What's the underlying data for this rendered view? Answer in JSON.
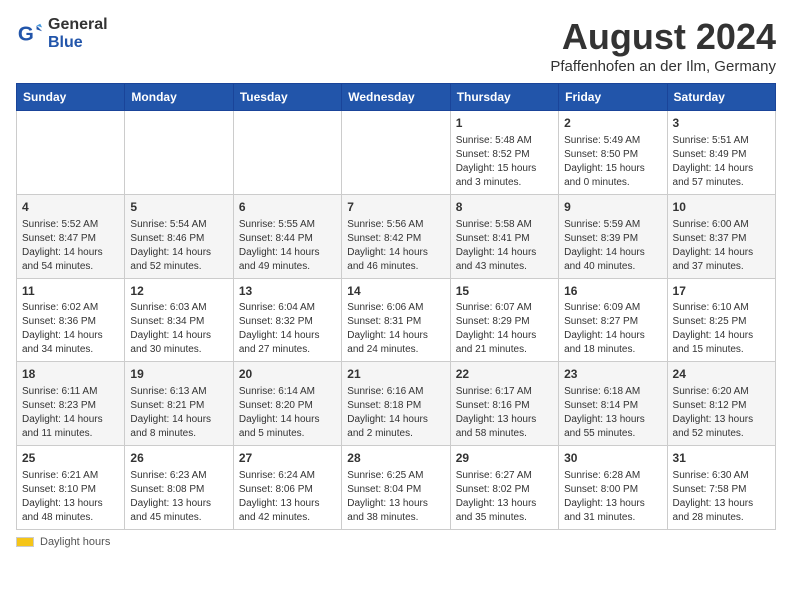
{
  "logo": {
    "general": "General",
    "blue": "Blue"
  },
  "title": "August 2024",
  "subtitle": "Pfaffenhofen an der Ilm, Germany",
  "days_of_week": [
    "Sunday",
    "Monday",
    "Tuesday",
    "Wednesday",
    "Thursday",
    "Friday",
    "Saturday"
  ],
  "weeks": [
    [
      {
        "day": "",
        "content": ""
      },
      {
        "day": "",
        "content": ""
      },
      {
        "day": "",
        "content": ""
      },
      {
        "day": "",
        "content": ""
      },
      {
        "day": "1",
        "content": "Sunrise: 5:48 AM\nSunset: 8:52 PM\nDaylight: 15 hours and 3 minutes."
      },
      {
        "day": "2",
        "content": "Sunrise: 5:49 AM\nSunset: 8:50 PM\nDaylight: 15 hours and 0 minutes."
      },
      {
        "day": "3",
        "content": "Sunrise: 5:51 AM\nSunset: 8:49 PM\nDaylight: 14 hours and 57 minutes."
      }
    ],
    [
      {
        "day": "4",
        "content": "Sunrise: 5:52 AM\nSunset: 8:47 PM\nDaylight: 14 hours and 54 minutes."
      },
      {
        "day": "5",
        "content": "Sunrise: 5:54 AM\nSunset: 8:46 PM\nDaylight: 14 hours and 52 minutes."
      },
      {
        "day": "6",
        "content": "Sunrise: 5:55 AM\nSunset: 8:44 PM\nDaylight: 14 hours and 49 minutes."
      },
      {
        "day": "7",
        "content": "Sunrise: 5:56 AM\nSunset: 8:42 PM\nDaylight: 14 hours and 46 minutes."
      },
      {
        "day": "8",
        "content": "Sunrise: 5:58 AM\nSunset: 8:41 PM\nDaylight: 14 hours and 43 minutes."
      },
      {
        "day": "9",
        "content": "Sunrise: 5:59 AM\nSunset: 8:39 PM\nDaylight: 14 hours and 40 minutes."
      },
      {
        "day": "10",
        "content": "Sunrise: 6:00 AM\nSunset: 8:37 PM\nDaylight: 14 hours and 37 minutes."
      }
    ],
    [
      {
        "day": "11",
        "content": "Sunrise: 6:02 AM\nSunset: 8:36 PM\nDaylight: 14 hours and 34 minutes."
      },
      {
        "day": "12",
        "content": "Sunrise: 6:03 AM\nSunset: 8:34 PM\nDaylight: 14 hours and 30 minutes."
      },
      {
        "day": "13",
        "content": "Sunrise: 6:04 AM\nSunset: 8:32 PM\nDaylight: 14 hours and 27 minutes."
      },
      {
        "day": "14",
        "content": "Sunrise: 6:06 AM\nSunset: 8:31 PM\nDaylight: 14 hours and 24 minutes."
      },
      {
        "day": "15",
        "content": "Sunrise: 6:07 AM\nSunset: 8:29 PM\nDaylight: 14 hours and 21 minutes."
      },
      {
        "day": "16",
        "content": "Sunrise: 6:09 AM\nSunset: 8:27 PM\nDaylight: 14 hours and 18 minutes."
      },
      {
        "day": "17",
        "content": "Sunrise: 6:10 AM\nSunset: 8:25 PM\nDaylight: 14 hours and 15 minutes."
      }
    ],
    [
      {
        "day": "18",
        "content": "Sunrise: 6:11 AM\nSunset: 8:23 PM\nDaylight: 14 hours and 11 minutes."
      },
      {
        "day": "19",
        "content": "Sunrise: 6:13 AM\nSunset: 8:21 PM\nDaylight: 14 hours and 8 minutes."
      },
      {
        "day": "20",
        "content": "Sunrise: 6:14 AM\nSunset: 8:20 PM\nDaylight: 14 hours and 5 minutes."
      },
      {
        "day": "21",
        "content": "Sunrise: 6:16 AM\nSunset: 8:18 PM\nDaylight: 14 hours and 2 minutes."
      },
      {
        "day": "22",
        "content": "Sunrise: 6:17 AM\nSunset: 8:16 PM\nDaylight: 13 hours and 58 minutes."
      },
      {
        "day": "23",
        "content": "Sunrise: 6:18 AM\nSunset: 8:14 PM\nDaylight: 13 hours and 55 minutes."
      },
      {
        "day": "24",
        "content": "Sunrise: 6:20 AM\nSunset: 8:12 PM\nDaylight: 13 hours and 52 minutes."
      }
    ],
    [
      {
        "day": "25",
        "content": "Sunrise: 6:21 AM\nSunset: 8:10 PM\nDaylight: 13 hours and 48 minutes."
      },
      {
        "day": "26",
        "content": "Sunrise: 6:23 AM\nSunset: 8:08 PM\nDaylight: 13 hours and 45 minutes."
      },
      {
        "day": "27",
        "content": "Sunrise: 6:24 AM\nSunset: 8:06 PM\nDaylight: 13 hours and 42 minutes."
      },
      {
        "day": "28",
        "content": "Sunrise: 6:25 AM\nSunset: 8:04 PM\nDaylight: 13 hours and 38 minutes."
      },
      {
        "day": "29",
        "content": "Sunrise: 6:27 AM\nSunset: 8:02 PM\nDaylight: 13 hours and 35 minutes."
      },
      {
        "day": "30",
        "content": "Sunrise: 6:28 AM\nSunset: 8:00 PM\nDaylight: 13 hours and 31 minutes."
      },
      {
        "day": "31",
        "content": "Sunrise: 6:30 AM\nSunset: 7:58 PM\nDaylight: 13 hours and 28 minutes."
      }
    ]
  ],
  "footer": {
    "daylight_label": "Daylight hours"
  }
}
